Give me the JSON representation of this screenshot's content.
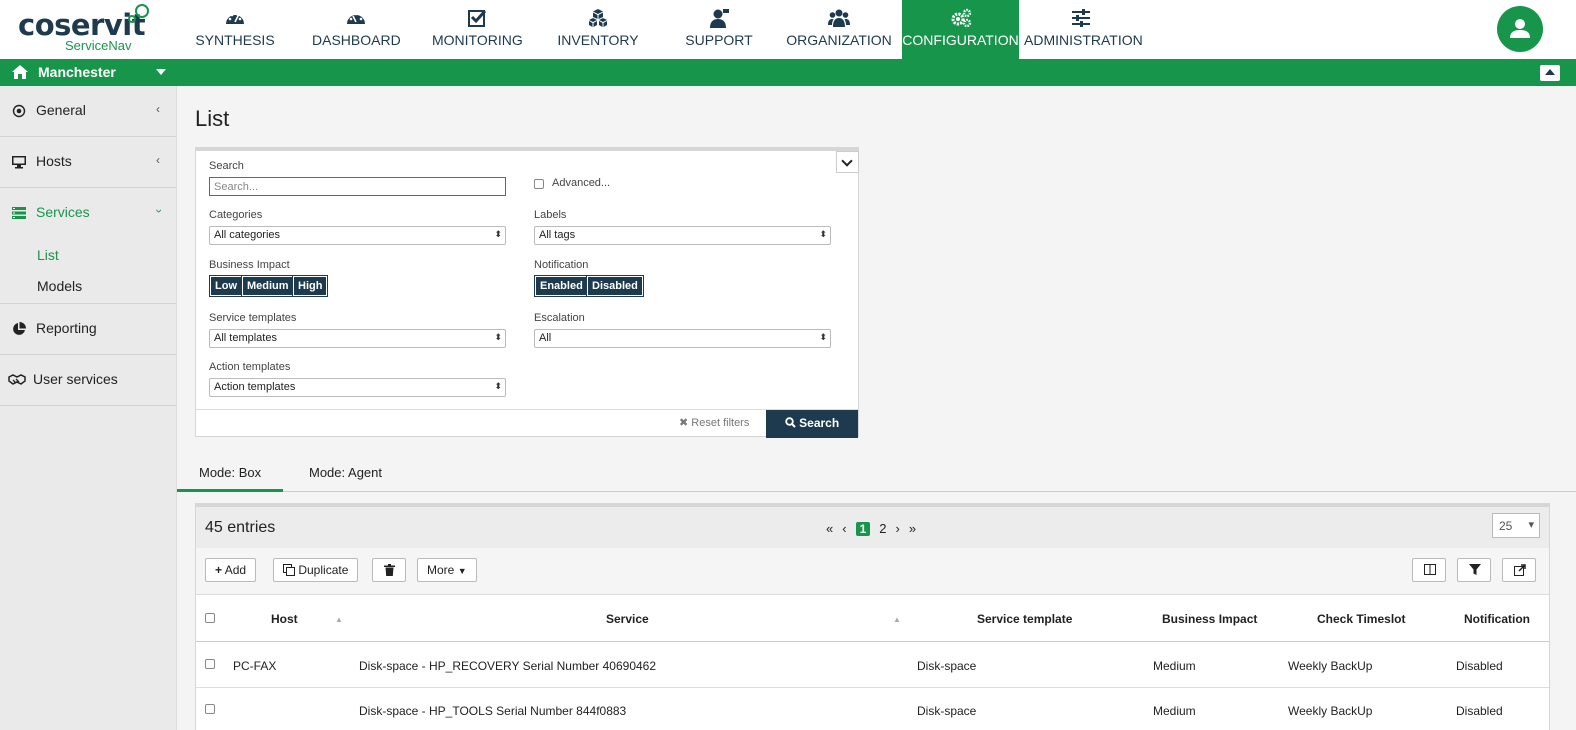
{
  "brand": {
    "name": "coservit",
    "product": "ServiceNav"
  },
  "nav": [
    {
      "label": "SYNTHESIS",
      "icon": "gauge-icon"
    },
    {
      "label": "DASHBOARD",
      "icon": "dashboard-icon"
    },
    {
      "label": "MONITORING",
      "icon": "check-square-icon"
    },
    {
      "label": "INVENTORY",
      "icon": "cubes-icon"
    },
    {
      "label": "SUPPORT",
      "icon": "support-agent-icon"
    },
    {
      "label": "ORGANIZATION",
      "icon": "users-icon"
    },
    {
      "label": "CONFIGURATION",
      "icon": "gears-icon",
      "active": true
    },
    {
      "label": "ADMINISTRATION",
      "icon": "sliders-icon"
    }
  ],
  "site": {
    "name": "Manchester"
  },
  "sidebar": {
    "items": [
      {
        "label": "General"
      },
      {
        "label": "Hosts"
      },
      {
        "label": "Services"
      },
      {
        "label": "Reporting"
      },
      {
        "label": "User services"
      }
    ],
    "services_sub": [
      {
        "label": "List"
      },
      {
        "label": "Models"
      }
    ]
  },
  "page": {
    "title": "List"
  },
  "filters": {
    "search_label": "Search",
    "search_placeholder": "Search...",
    "advanced_label": "Advanced...",
    "categories_label": "Categories",
    "categories_value": "All categories",
    "labels_label": "Labels",
    "labels_value": "All tags",
    "impact_label": "Business Impact",
    "impact_options": [
      "Low",
      "Medium",
      "High"
    ],
    "notification_label": "Notification",
    "notification_options": [
      "Enabled",
      "Disabled"
    ],
    "service_templates_label": "Service templates",
    "service_templates_value": "All templates",
    "escalation_label": "Escalation",
    "escalation_value": "All",
    "action_templates_label": "Action templates",
    "action_templates_value": "Action templates",
    "reset_label": "✖ Reset filters",
    "search_button": "Search"
  },
  "tabs": [
    {
      "label": "Mode: Box",
      "active": true
    },
    {
      "label": "Mode: Agent"
    }
  ],
  "table": {
    "entries": "45 entries",
    "pages": {
      "first": "«",
      "prev": "‹",
      "current": "1",
      "other": "2",
      "next": "›",
      "last": "»"
    },
    "page_size": "25",
    "toolbar": {
      "add": "Add",
      "duplicate": "Duplicate",
      "more": "More"
    },
    "columns": [
      "Host",
      "Service",
      "Service template",
      "Business Impact",
      "Check Timeslot",
      "Notification"
    ],
    "rows": [
      {
        "host": "PC-FAX",
        "service": "Disk-space - HP_RECOVERY Serial Number 40690462",
        "template": "Disk-space",
        "impact": "Medium",
        "timeslot": "Weekly BackUp",
        "notification": "Disabled"
      },
      {
        "host": "",
        "service": "Disk-space - HP_TOOLS Serial Number 844f0883",
        "template": "Disk-space",
        "impact": "Medium",
        "timeslot": "Weekly BackUp",
        "notification": "Disabled"
      }
    ]
  },
  "colors": {
    "accent": "#17964b",
    "navy": "#1d3a4e"
  }
}
